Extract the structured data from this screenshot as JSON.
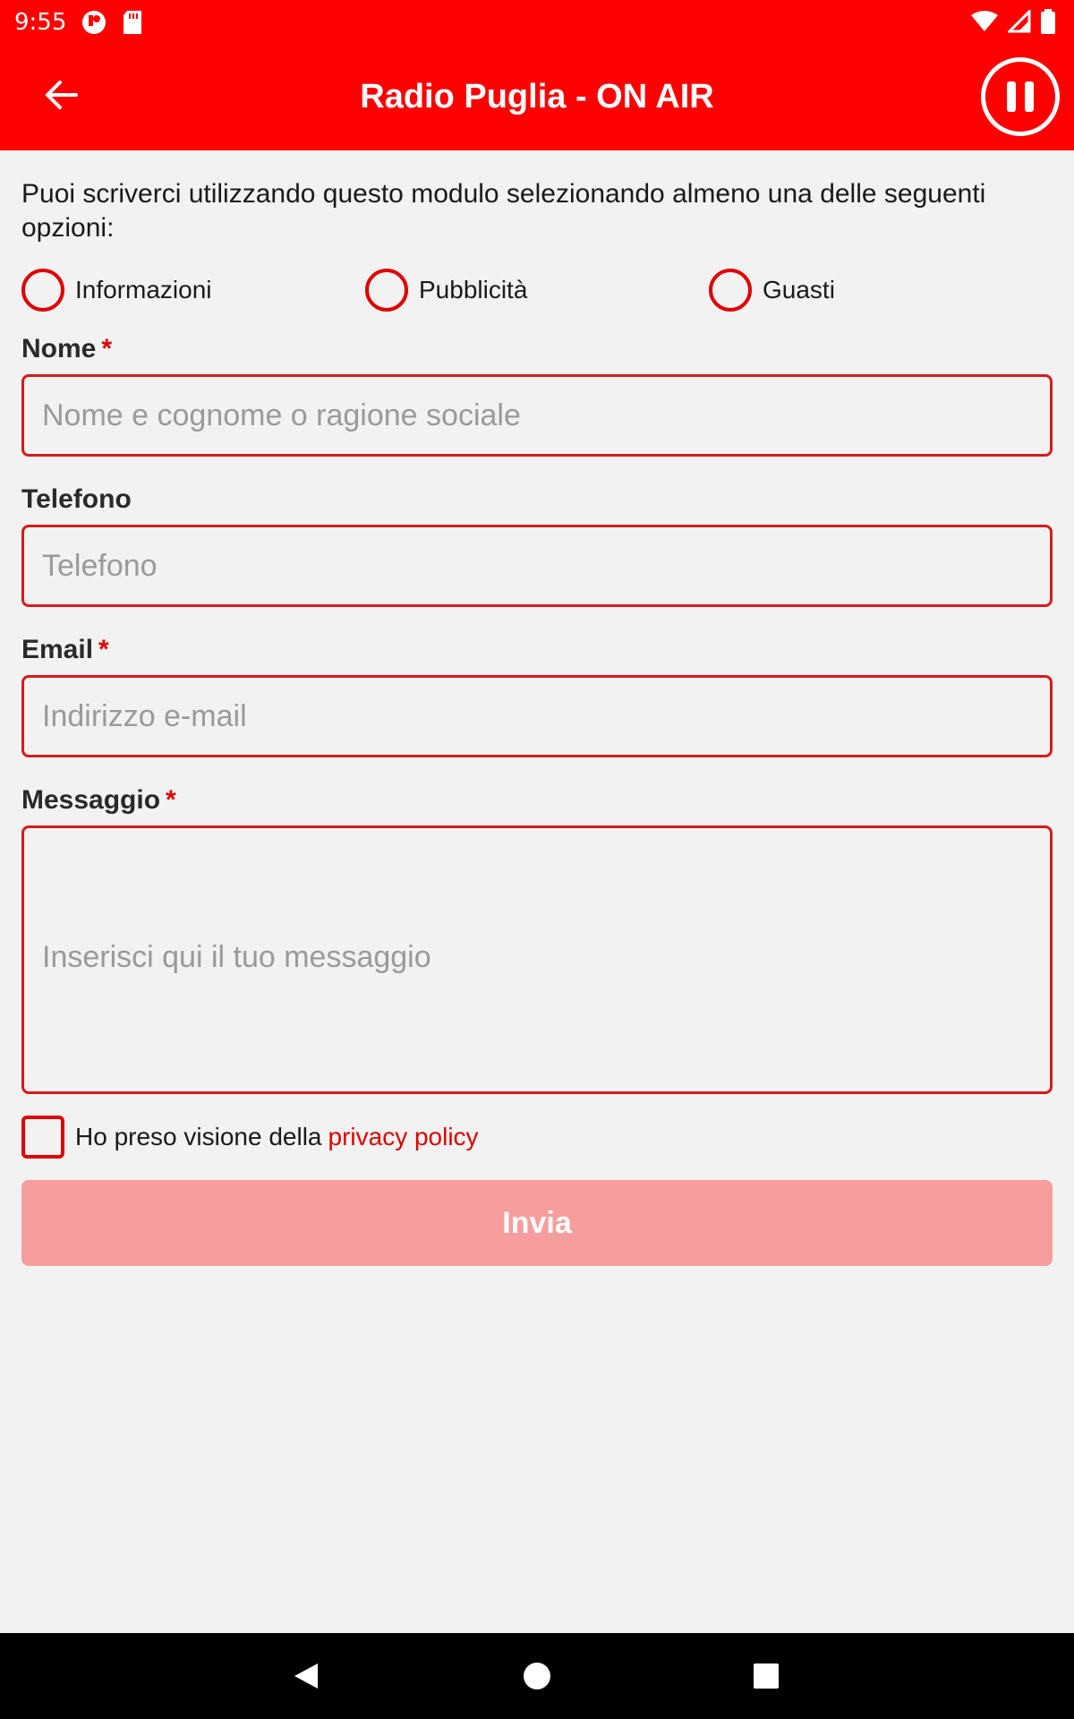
{
  "status_bar": {
    "time": "9:55",
    "left_icons": [
      "app-notification-icon",
      "sd-card-icon"
    ],
    "right_icons": [
      "wifi-icon",
      "signal-icon",
      "battery-icon"
    ]
  },
  "app_bar": {
    "title": "Radio Puglia - ON AIR",
    "back_icon": "arrow-back-icon",
    "player_icon": "pause-icon",
    "color": "#fe0000"
  },
  "form": {
    "intro": "Puoi scriverci utilizzando questo modulo selezionando almeno una delle seguenti opzioni:",
    "options": [
      {
        "label": "Informazioni",
        "selected": false
      },
      {
        "label": "Pubblicità",
        "selected": false
      },
      {
        "label": "Guasti",
        "selected": false
      }
    ],
    "required_marker": "*",
    "fields": {
      "nome": {
        "label": "Nome",
        "required": true,
        "placeholder": "Nome e cognome o ragione sociale",
        "value": ""
      },
      "telefono": {
        "label": "Telefono",
        "required": false,
        "placeholder": "Telefono",
        "value": ""
      },
      "email": {
        "label": "Email",
        "required": true,
        "placeholder": "Indirizzo e-mail",
        "value": ""
      },
      "messaggio": {
        "label": "Messaggio",
        "required": true,
        "placeholder": "Inserisci qui il tuo messaggio",
        "value": ""
      }
    },
    "privacy": {
      "text": "Ho preso visione della",
      "link": "privacy policy",
      "checked": false
    },
    "submit_label": "Invia",
    "submit_enabled": false,
    "accent_color": "#e00000",
    "submit_disabled_color": "#f69d9d"
  },
  "nav_bar": {
    "buttons": [
      "nav-back-icon",
      "nav-home-icon",
      "nav-recents-icon"
    ]
  }
}
